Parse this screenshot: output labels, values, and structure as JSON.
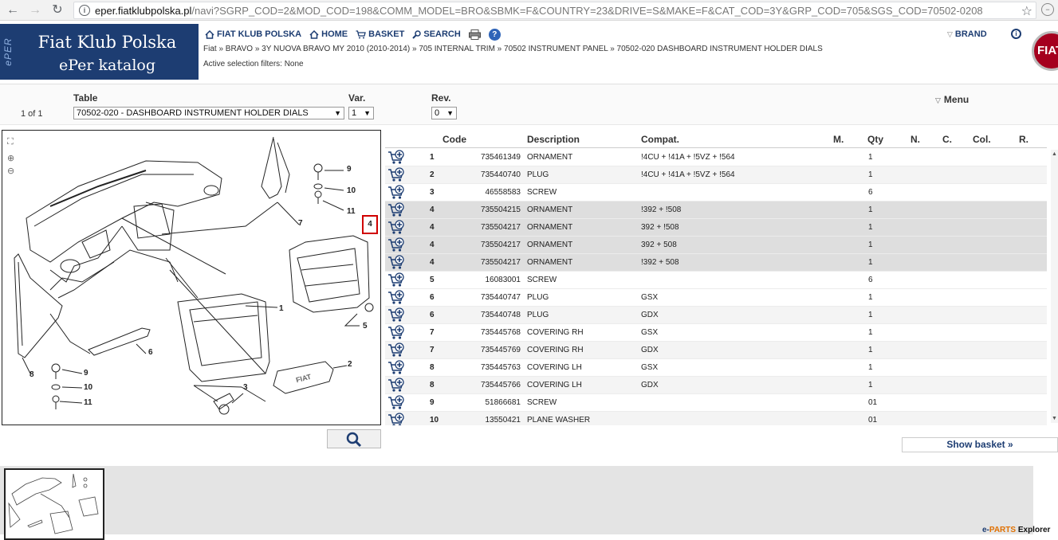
{
  "browser": {
    "url_host": "eper.fiatklubpolska.pl",
    "url_path": "/navi?SGRP_COD=2&MOD_COD=198&COMM_MODEL=BRO&SBMK=F&COUNTRY=23&DRIVE=S&MAKE=F&CAT_COD=3Y&GRP_COD=705&SGS_COD=70502-0208"
  },
  "logo": {
    "line1": "Fiat Klub Polska",
    "line2": "ePer katalog",
    "strip": "ePER"
  },
  "nav": [
    {
      "label": "FIAT KLUB POLSKA",
      "icon": "home-icon"
    },
    {
      "label": "HOME",
      "icon": "home-icon"
    },
    {
      "label": "BASKET",
      "icon": "cart-icon"
    },
    {
      "label": "SEARCH",
      "icon": "search-icon"
    }
  ],
  "brand_label": "BRAND",
  "fiat_logo_text": "FIAT",
  "breadcrumb": "Fiat » BRAVO » 3Y NUOVA BRAVO MY 2010 (2010-2014) » 705 INTERNAL TRIM » 70502 INSTRUMENT PANEL » 70502-020 DASHBOARD INSTRUMENT HOLDER DIALS",
  "filters": "Active selection filters: None",
  "selector": {
    "table_label": "Table",
    "var_label": "Var.",
    "rev_label": "Rev.",
    "pager": "1 of 1",
    "table_value": "70502-020 - DASHBOARD INSTRUMENT HOLDER DIALS",
    "var_value": "1",
    "rev_value": "0",
    "menu_label": "Menu"
  },
  "columns": [
    "Code",
    "Description",
    "Compat.",
    "M.",
    "Qty",
    "N.",
    "C.",
    "Col.",
    "R."
  ],
  "rows": [
    {
      "n": "1",
      "code": "735461349",
      "desc": "ORNAMENT",
      "compat": "!4CU + !41A + !5VZ + !564",
      "qty": "1",
      "style": ""
    },
    {
      "n": "2",
      "code": "735440740",
      "desc": "PLUG",
      "compat": "!4CU + !41A + !5VZ + !564",
      "qty": "1",
      "style": "alt"
    },
    {
      "n": "3",
      "code": "46558583",
      "desc": "SCREW",
      "compat": "",
      "qty": "6",
      "style": ""
    },
    {
      "n": "4",
      "code": "735504215",
      "desc": "ORNAMENT",
      "compat": "!392 + !508",
      "qty": "1",
      "style": "hl"
    },
    {
      "n": "4",
      "code": "735504217",
      "desc": "ORNAMENT",
      "compat": "392 + !508",
      "qty": "1",
      "style": "hl"
    },
    {
      "n": "4",
      "code": "735504217",
      "desc": "ORNAMENT",
      "compat": "392 + 508",
      "qty": "1",
      "style": "hl"
    },
    {
      "n": "4",
      "code": "735504217",
      "desc": "ORNAMENT",
      "compat": "!392 + 508",
      "qty": "1",
      "style": "hl"
    },
    {
      "n": "5",
      "code": "16083001",
      "desc": "SCREW",
      "compat": "",
      "qty": "6",
      "style": ""
    },
    {
      "n": "6",
      "code": "735440747",
      "desc": "PLUG",
      "compat": "GSX",
      "qty": "1",
      "style": ""
    },
    {
      "n": "6",
      "code": "735440748",
      "desc": "PLUG",
      "compat": "GDX",
      "qty": "1",
      "style": "alt"
    },
    {
      "n": "7",
      "code": "735445768",
      "desc": "COVERING RH",
      "compat": "GSX",
      "qty": "1",
      "style": ""
    },
    {
      "n": "7",
      "code": "735445769",
      "desc": "COVERING RH",
      "compat": "GDX",
      "qty": "1",
      "style": "alt"
    },
    {
      "n": "8",
      "code": "735445763",
      "desc": "COVERING LH",
      "compat": "GSX",
      "qty": "1",
      "style": ""
    },
    {
      "n": "8",
      "code": "735445766",
      "desc": "COVERING LH",
      "compat": "GDX",
      "qty": "1",
      "style": "alt"
    },
    {
      "n": "9",
      "code": "51866681",
      "desc": "SCREW",
      "compat": "",
      "qty": "01",
      "style": ""
    },
    {
      "n": "10",
      "code": "13550421",
      "desc": "PLANE WASHER",
      "compat": "",
      "qty": "01",
      "style": "alt"
    }
  ],
  "drawing_callouts": [
    "9",
    "10",
    "11",
    "7",
    "4",
    "1",
    "5",
    "6",
    "8",
    "9",
    "10",
    "11",
    "3",
    "2"
  ],
  "drawing_badge": "FIAT",
  "basket_button": "Show basket »",
  "footer": {
    "e": "e-",
    "parts": "PARTS",
    "explorer": "Explorer"
  }
}
